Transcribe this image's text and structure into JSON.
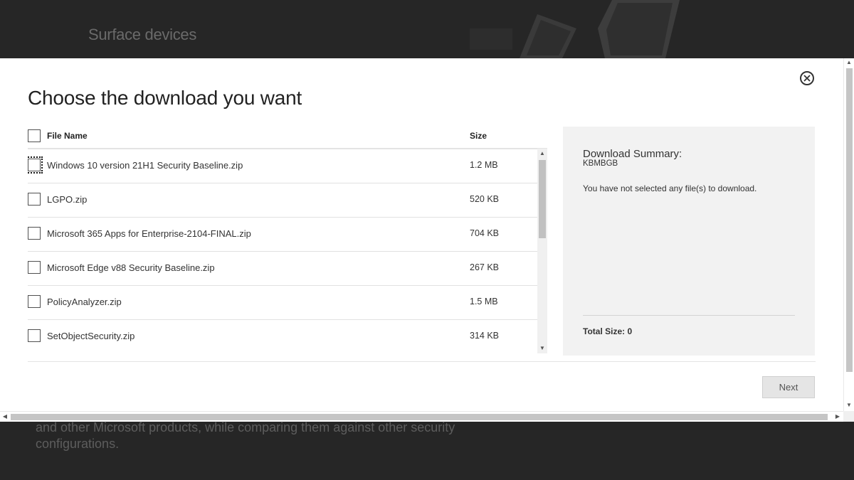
{
  "background": {
    "title": "Surface devices",
    "text": "and other Microsoft products, while comparing them against other security configurations."
  },
  "dialog": {
    "title": "Choose the download you want",
    "close_icon": "close-circle-icon",
    "columns": {
      "name": "File Name",
      "size": "Size"
    },
    "files": [
      {
        "name": "Windows 10 version 21H1 Security Baseline.zip",
        "size": "1.2 MB"
      },
      {
        "name": "LGPO.zip",
        "size": "520 KB"
      },
      {
        "name": "Microsoft 365 Apps for Enterprise-2104-FINAL.zip",
        "size": "704 KB"
      },
      {
        "name": "Microsoft Edge v88 Security Baseline.zip",
        "size": "267 KB"
      },
      {
        "name": "PolicyAnalyzer.zip",
        "size": "1.5 MB"
      },
      {
        "name": "SetObjectSecurity.zip",
        "size": "314 KB"
      }
    ],
    "summary": {
      "title": "Download Summary:",
      "code": "KBMBGB",
      "message": "You have not selected any file(s) to download.",
      "total": "Total Size: 0"
    },
    "next_label": "Next"
  }
}
